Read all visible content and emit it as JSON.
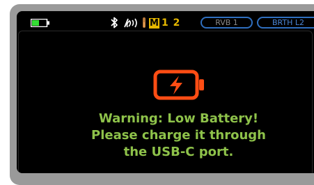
{
  "status_bar": {
    "battery_icon": "battery-low-icon",
    "bluetooth_icon": "bluetooth-icon",
    "sensor_icon": "signal-waves-icon",
    "temperature_icon": "thermometer-icon",
    "mode_letter": "M",
    "mode_numbers": "1 2",
    "reverb_label": "RVB 1",
    "breath_label": "BRTH L2"
  },
  "warning": {
    "icon": "battery-charging-warning-icon",
    "line1": "Warning: Low Battery!",
    "line2": "Please charge it through",
    "line3": "the USB-C port."
  },
  "colors": {
    "bezel": "#9a9a9a",
    "screen": "#000000",
    "warning_text": "#8ec24a",
    "warning_icon": "#ff4d14",
    "battery": "#33dd33",
    "mode_accent": "#e6b800",
    "pill_border": "#2f6fbf"
  }
}
